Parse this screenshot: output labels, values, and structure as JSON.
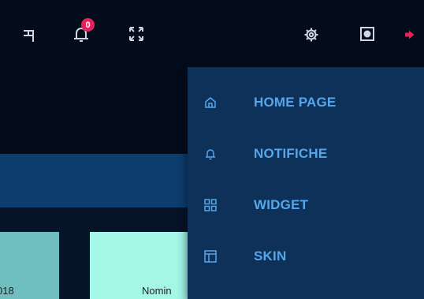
{
  "topbar": {
    "icons": [
      "drawer-icon",
      "bell-icon",
      "fullscreen-icon",
      "gear-icon",
      "camera-icon",
      "logout-icon"
    ],
    "notification_count": "0"
  },
  "tiles": {
    "tile1_text": "018",
    "tile2_text": "Nomin"
  },
  "menu": {
    "items": [
      {
        "label": "HOME PAGE",
        "icon": "home-icon"
      },
      {
        "label": "NOTIFICHE",
        "icon": "bell-icon"
      },
      {
        "label": "WIDGET",
        "icon": "grid-icon"
      },
      {
        "label": "SKIN",
        "icon": "layout-icon"
      }
    ]
  },
  "colors": {
    "topbar_bg": "#040c1b",
    "menu_bg": "#0d3158",
    "menu_text": "#57a6ec",
    "band": "#0d3d6e",
    "badge": "#e7205a",
    "tile1": "#6fbfc1",
    "tile2": "#a4f6e7"
  }
}
